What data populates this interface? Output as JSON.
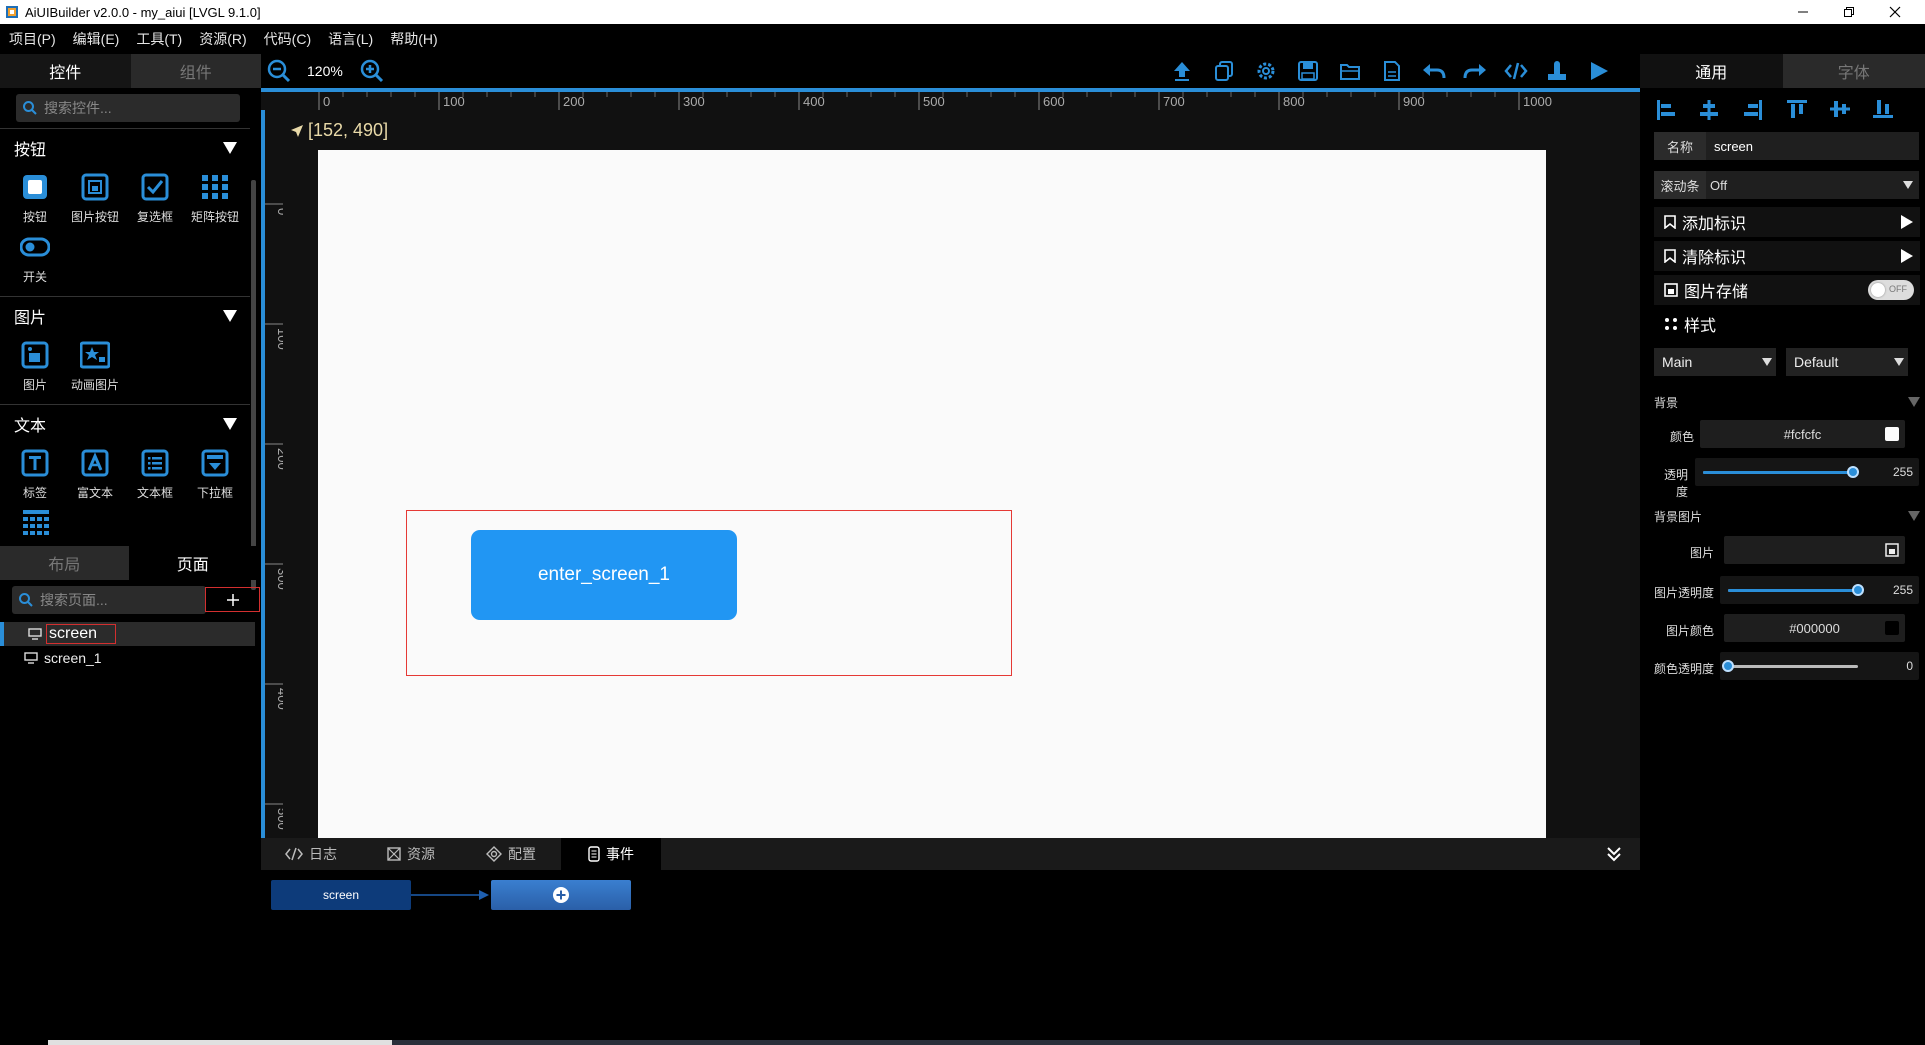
{
  "window": {
    "title": "AiUIBuilder v2.0.0 - my_aiui [LVGL 9.1.0]"
  },
  "menu": [
    {
      "label": "项目(P)"
    },
    {
      "label": "编辑(E)"
    },
    {
      "label": "工具(T)"
    },
    {
      "label": "资源(R)"
    },
    {
      "label": "代码(C)"
    },
    {
      "label": "语言(L)"
    },
    {
      "label": "帮助(H)"
    }
  ],
  "left_panel": {
    "tabs": {
      "active": "控件",
      "inactive": "组件"
    },
    "search_placeholder": "搜索控件...",
    "sections": [
      {
        "title": "按钮",
        "widgets": [
          {
            "label": "按钮",
            "icon": "button-icon"
          },
          {
            "label": "图片按钮",
            "icon": "image-button-icon"
          },
          {
            "label": "复选框",
            "icon": "checkbox-icon"
          },
          {
            "label": "矩阵按钮",
            "icon": "matrix-button-icon"
          },
          {
            "label": "开关",
            "icon": "switch-icon"
          }
        ]
      },
      {
        "title": "图片",
        "widgets": [
          {
            "label": "图片",
            "icon": "image-icon"
          },
          {
            "label": "动画图片",
            "icon": "animated-image-icon"
          }
        ]
      },
      {
        "title": "文本",
        "widgets": [
          {
            "label": "标签",
            "icon": "label-icon"
          },
          {
            "label": "富文本",
            "icon": "rich-text-icon"
          },
          {
            "label": "文本框",
            "icon": "textarea-icon"
          },
          {
            "label": "下拉框",
            "icon": "dropdown-icon"
          }
        ]
      }
    ],
    "page_tabs": {
      "inactive": "布局",
      "active": "页面"
    },
    "page_search_placeholder": "搜索页面...",
    "pages": [
      {
        "name": "screen",
        "selected": true
      },
      {
        "name": "screen_1",
        "selected": false
      }
    ]
  },
  "toolbar": {
    "zoom": "120%",
    "icons": [
      "upload-icon",
      "copy-icon",
      "settings-icon",
      "save-icon",
      "open-folder-icon",
      "new-file-icon",
      "undo-icon",
      "redo-icon",
      "code-icon",
      "build-icon",
      "run-icon"
    ]
  },
  "ruler": {
    "h_ticks": [
      "0",
      "100",
      "200",
      "300",
      "400",
      "500",
      "600",
      "700",
      "800",
      "900",
      "1000"
    ],
    "v_ticks": [
      "0",
      "100",
      "200",
      "300",
      "400",
      "500"
    ]
  },
  "canvas": {
    "cursor_coords": "[152, 490]",
    "button_label": "enter_screen_1",
    "bg_color": "#fafafa",
    "button_color": "#2196f3"
  },
  "bottom_panel": {
    "tabs": [
      {
        "label": "日志",
        "icon": "code-icon"
      },
      {
        "label": "资源",
        "icon": "resource-icon"
      },
      {
        "label": "配置",
        "icon": "config-icon"
      },
      {
        "label": "事件",
        "icon": "event-icon"
      }
    ],
    "active_tab": "事件",
    "event_node": "screen"
  },
  "right_panel": {
    "tabs": {
      "active": "通用",
      "inactive": "字体"
    },
    "name_label": "名称",
    "name_value": "screen",
    "scrollbar_label": "滚动条",
    "scrollbar_value": "Off",
    "add_tag": "添加标识",
    "clear_tag": "清除标识",
    "image_store": "图片存储",
    "image_store_toggle": "OFF",
    "style_title": "样式",
    "part_select": "Main",
    "state_select": "Default",
    "bg_section": "背景",
    "color_label": "颜色",
    "color_value": "#fcfcfc",
    "opacity_label": "透明度",
    "opacity_value": "255",
    "bg_image_section": "背景图片",
    "image_label": "图片",
    "image_opacity_label": "图片透明度",
    "image_opacity_value": "255",
    "image_color_label": "图片颜色",
    "image_color_value": "#000000",
    "color_opacity_label": "颜色透明度",
    "color_opacity_value": "0",
    "accent": "#2a8ed8"
  }
}
